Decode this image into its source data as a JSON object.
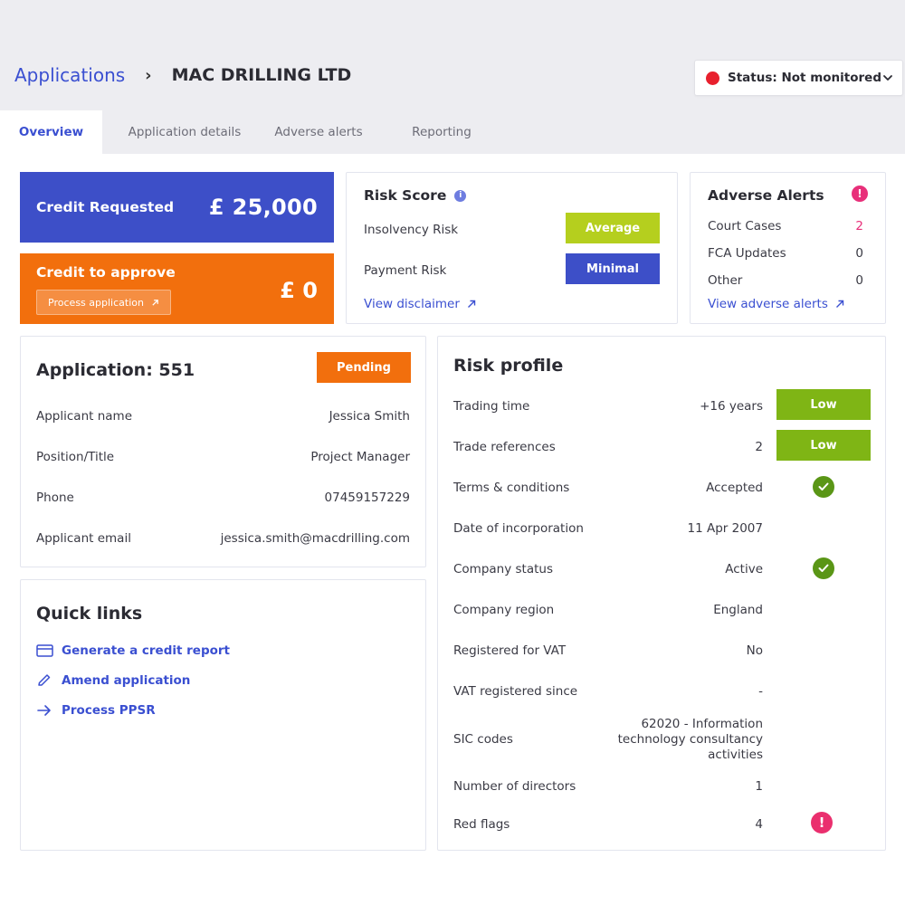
{
  "header": {
    "breadcrumb_root": "Applications",
    "breadcrumb_sep": "›",
    "company_name": "MAC DRILLING LTD",
    "status_label": "Status: Not monitored",
    "status_color": "#e8202d"
  },
  "tabs": [
    {
      "label": "Overview",
      "active": true
    },
    {
      "label": "Application details",
      "active": false
    },
    {
      "label": "Adverse alerts",
      "active": false
    },
    {
      "label": "Reporting",
      "active": false
    }
  ],
  "credit_requested": {
    "label": "Credit Requested",
    "amount": "£ 25,000",
    "color": "#3d4fc8"
  },
  "credit_to_approve": {
    "label": "Credit to approve",
    "amount": "£ 0",
    "button_label": "Process application",
    "color": "#f26f0d"
  },
  "risk_score": {
    "title": "Risk Score",
    "info_icon": "i",
    "rows": [
      {
        "label": "Insolvency Risk",
        "value": "Average",
        "color": "#b5cf1e"
      },
      {
        "label": "Payment Risk",
        "value": "Minimal",
        "color": "#3d4fc8"
      }
    ],
    "link": "View disclaimer"
  },
  "adverse_alerts": {
    "title": "Adverse Alerts",
    "alert_icon": "!",
    "rows": [
      {
        "label": "Court Cases",
        "value": "2",
        "highlight": true
      },
      {
        "label": "FCA Updates",
        "value": "0",
        "highlight": false
      },
      {
        "label": "Other",
        "value": "0",
        "highlight": false
      }
    ],
    "link": "View adverse alerts"
  },
  "application": {
    "title": "Application: 551",
    "status": "Pending",
    "status_color": "#f26f0d",
    "rows": [
      {
        "label": "Applicant name",
        "value": "Jessica Smith"
      },
      {
        "label": "Position/Title",
        "value": "Project Manager"
      },
      {
        "label": "Phone",
        "value": "07459157229"
      },
      {
        "label": "Applicant email",
        "value": "jessica.smith@macdrilling.com"
      }
    ]
  },
  "quick_links": {
    "title": "Quick links",
    "items": [
      {
        "label": "Generate a credit report",
        "icon": "card-icon"
      },
      {
        "label": "Amend application",
        "icon": "pencil-icon"
      },
      {
        "label": "Process PPSR",
        "icon": "arrow-right-icon"
      }
    ]
  },
  "risk_profile": {
    "title": "Risk profile",
    "rows": [
      {
        "label": "Trading time",
        "value": "+16 years",
        "indicator": "Low"
      },
      {
        "label": "Trade references",
        "value": "2",
        "indicator": "Low"
      },
      {
        "label": "Terms & conditions",
        "value": "Accepted",
        "indicator": "check"
      },
      {
        "label": "Date of incorporation",
        "value": "11 Apr 2007",
        "indicator": ""
      },
      {
        "label": "Company status",
        "value": "Active",
        "indicator": "check"
      },
      {
        "label": "Company region",
        "value": "England",
        "indicator": ""
      },
      {
        "label": "Registered for VAT",
        "value": "No",
        "indicator": ""
      },
      {
        "label": "VAT registered since",
        "value": "-",
        "indicator": ""
      },
      {
        "label": "SIC codes",
        "value": "62020 - Information technology consultancy activities",
        "indicator": ""
      },
      {
        "label": "Number of directors",
        "value": "1",
        "indicator": ""
      },
      {
        "label": "Red flags",
        "value": "4",
        "indicator": "alert"
      }
    ],
    "low_color": "#7fb515"
  }
}
